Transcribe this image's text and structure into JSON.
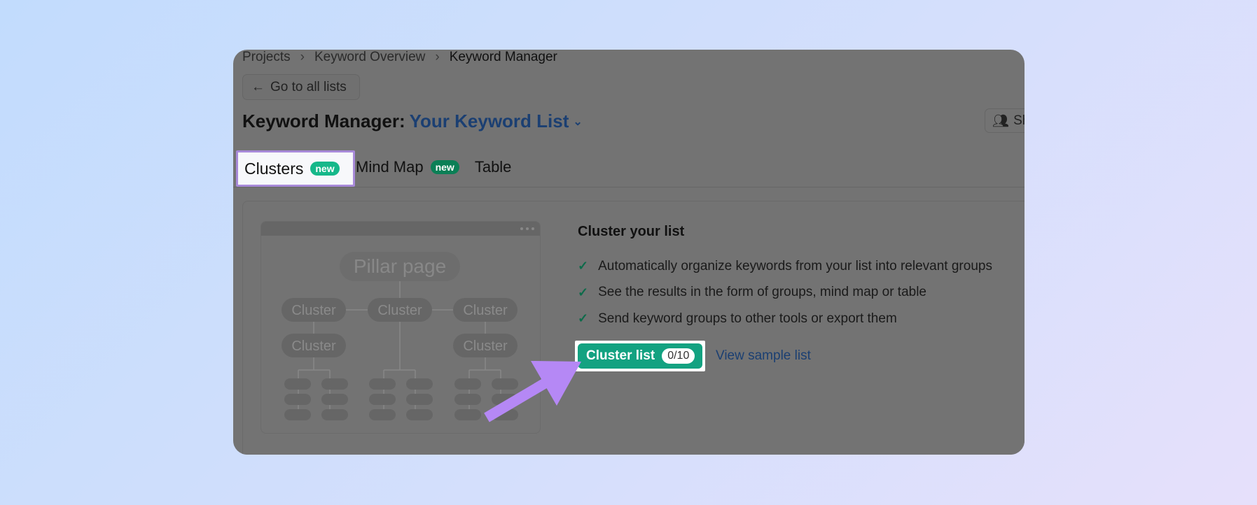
{
  "breadcrumb": [
    "Projects",
    "Keyword Overview",
    "Keyword Manager"
  ],
  "back_button": "Go to all lists",
  "title": {
    "prefix": "Keyword Manager:",
    "list_name": "Your Keyword List"
  },
  "share_button": "Sh",
  "tabs": [
    {
      "label": "Clusters",
      "badge": "new",
      "highlighted": true
    },
    {
      "label": "Mind Map",
      "badge": "new"
    },
    {
      "label": "Table"
    }
  ],
  "illustration": {
    "pillar": "Pillar page",
    "cluster": "Cluster"
  },
  "content": {
    "heading": "Cluster your list",
    "bullets": [
      "Automatically organize keywords from your list into relevant groups",
      "See the results in the form of groups, mind map or table",
      "Send keyword groups to other tools or export them"
    ],
    "cta": {
      "label": "Cluster list",
      "count": "0/10"
    },
    "sample_link": "View sample list"
  },
  "colors": {
    "accent": "#13a281",
    "highlight": "#a88ad9",
    "arrow": "#b588f5",
    "link": "#1b3f72"
  }
}
